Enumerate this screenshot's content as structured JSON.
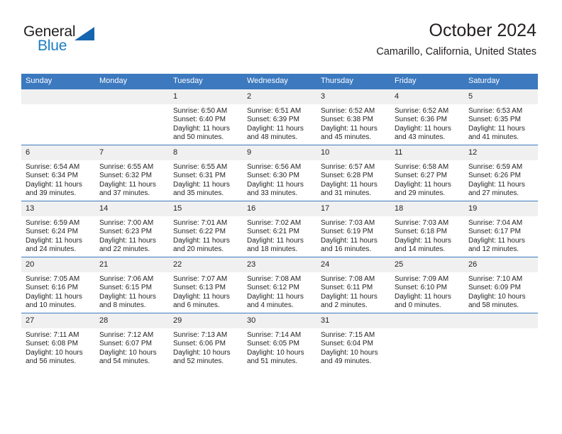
{
  "logo": {
    "word1": "General",
    "word2": "Blue",
    "icon": "triangle-icon",
    "brand_color": "#1a7dc4",
    "triangle_color": "#1565b0"
  },
  "header": {
    "title": "October 2024",
    "subtitle": "Camarillo, California, United States"
  },
  "theme": {
    "header_blue": "#3c79bf",
    "date_band": "#f0f0f0",
    "text": "#231f20"
  },
  "weekdays": [
    "Sunday",
    "Monday",
    "Tuesday",
    "Wednesday",
    "Thursday",
    "Friday",
    "Saturday"
  ],
  "weeks": [
    [
      {
        "day": "",
        "empty": true
      },
      {
        "day": "",
        "empty": true
      },
      {
        "day": "1",
        "sunrise": "Sunrise: 6:50 AM",
        "sunset": "Sunset: 6:40 PM",
        "daylight1": "Daylight: 11 hours",
        "daylight2": "and 50 minutes."
      },
      {
        "day": "2",
        "sunrise": "Sunrise: 6:51 AM",
        "sunset": "Sunset: 6:39 PM",
        "daylight1": "Daylight: 11 hours",
        "daylight2": "and 48 minutes."
      },
      {
        "day": "3",
        "sunrise": "Sunrise: 6:52 AM",
        "sunset": "Sunset: 6:38 PM",
        "daylight1": "Daylight: 11 hours",
        "daylight2": "and 45 minutes."
      },
      {
        "day": "4",
        "sunrise": "Sunrise: 6:52 AM",
        "sunset": "Sunset: 6:36 PM",
        "daylight1": "Daylight: 11 hours",
        "daylight2": "and 43 minutes."
      },
      {
        "day": "5",
        "sunrise": "Sunrise: 6:53 AM",
        "sunset": "Sunset: 6:35 PM",
        "daylight1": "Daylight: 11 hours",
        "daylight2": "and 41 minutes."
      }
    ],
    [
      {
        "day": "6",
        "sunrise": "Sunrise: 6:54 AM",
        "sunset": "Sunset: 6:34 PM",
        "daylight1": "Daylight: 11 hours",
        "daylight2": "and 39 minutes."
      },
      {
        "day": "7",
        "sunrise": "Sunrise: 6:55 AM",
        "sunset": "Sunset: 6:32 PM",
        "daylight1": "Daylight: 11 hours",
        "daylight2": "and 37 minutes."
      },
      {
        "day": "8",
        "sunrise": "Sunrise: 6:55 AM",
        "sunset": "Sunset: 6:31 PM",
        "daylight1": "Daylight: 11 hours",
        "daylight2": "and 35 minutes."
      },
      {
        "day": "9",
        "sunrise": "Sunrise: 6:56 AM",
        "sunset": "Sunset: 6:30 PM",
        "daylight1": "Daylight: 11 hours",
        "daylight2": "and 33 minutes."
      },
      {
        "day": "10",
        "sunrise": "Sunrise: 6:57 AM",
        "sunset": "Sunset: 6:28 PM",
        "daylight1": "Daylight: 11 hours",
        "daylight2": "and 31 minutes."
      },
      {
        "day": "11",
        "sunrise": "Sunrise: 6:58 AM",
        "sunset": "Sunset: 6:27 PM",
        "daylight1": "Daylight: 11 hours",
        "daylight2": "and 29 minutes."
      },
      {
        "day": "12",
        "sunrise": "Sunrise: 6:59 AM",
        "sunset": "Sunset: 6:26 PM",
        "daylight1": "Daylight: 11 hours",
        "daylight2": "and 27 minutes."
      }
    ],
    [
      {
        "day": "13",
        "sunrise": "Sunrise: 6:59 AM",
        "sunset": "Sunset: 6:24 PM",
        "daylight1": "Daylight: 11 hours",
        "daylight2": "and 24 minutes."
      },
      {
        "day": "14",
        "sunrise": "Sunrise: 7:00 AM",
        "sunset": "Sunset: 6:23 PM",
        "daylight1": "Daylight: 11 hours",
        "daylight2": "and 22 minutes."
      },
      {
        "day": "15",
        "sunrise": "Sunrise: 7:01 AM",
        "sunset": "Sunset: 6:22 PM",
        "daylight1": "Daylight: 11 hours",
        "daylight2": "and 20 minutes."
      },
      {
        "day": "16",
        "sunrise": "Sunrise: 7:02 AM",
        "sunset": "Sunset: 6:21 PM",
        "daylight1": "Daylight: 11 hours",
        "daylight2": "and 18 minutes."
      },
      {
        "day": "17",
        "sunrise": "Sunrise: 7:03 AM",
        "sunset": "Sunset: 6:19 PM",
        "daylight1": "Daylight: 11 hours",
        "daylight2": "and 16 minutes."
      },
      {
        "day": "18",
        "sunrise": "Sunrise: 7:03 AM",
        "sunset": "Sunset: 6:18 PM",
        "daylight1": "Daylight: 11 hours",
        "daylight2": "and 14 minutes."
      },
      {
        "day": "19",
        "sunrise": "Sunrise: 7:04 AM",
        "sunset": "Sunset: 6:17 PM",
        "daylight1": "Daylight: 11 hours",
        "daylight2": "and 12 minutes."
      }
    ],
    [
      {
        "day": "20",
        "sunrise": "Sunrise: 7:05 AM",
        "sunset": "Sunset: 6:16 PM",
        "daylight1": "Daylight: 11 hours",
        "daylight2": "and 10 minutes."
      },
      {
        "day": "21",
        "sunrise": "Sunrise: 7:06 AM",
        "sunset": "Sunset: 6:15 PM",
        "daylight1": "Daylight: 11 hours",
        "daylight2": "and 8 minutes."
      },
      {
        "day": "22",
        "sunrise": "Sunrise: 7:07 AM",
        "sunset": "Sunset: 6:13 PM",
        "daylight1": "Daylight: 11 hours",
        "daylight2": "and 6 minutes."
      },
      {
        "day": "23",
        "sunrise": "Sunrise: 7:08 AM",
        "sunset": "Sunset: 6:12 PM",
        "daylight1": "Daylight: 11 hours",
        "daylight2": "and 4 minutes."
      },
      {
        "day": "24",
        "sunrise": "Sunrise: 7:08 AM",
        "sunset": "Sunset: 6:11 PM",
        "daylight1": "Daylight: 11 hours",
        "daylight2": "and 2 minutes."
      },
      {
        "day": "25",
        "sunrise": "Sunrise: 7:09 AM",
        "sunset": "Sunset: 6:10 PM",
        "daylight1": "Daylight: 11 hours",
        "daylight2": "and 0 minutes."
      },
      {
        "day": "26",
        "sunrise": "Sunrise: 7:10 AM",
        "sunset": "Sunset: 6:09 PM",
        "daylight1": "Daylight: 10 hours",
        "daylight2": "and 58 minutes."
      }
    ],
    [
      {
        "day": "27",
        "sunrise": "Sunrise: 7:11 AM",
        "sunset": "Sunset: 6:08 PM",
        "daylight1": "Daylight: 10 hours",
        "daylight2": "and 56 minutes."
      },
      {
        "day": "28",
        "sunrise": "Sunrise: 7:12 AM",
        "sunset": "Sunset: 6:07 PM",
        "daylight1": "Daylight: 10 hours",
        "daylight2": "and 54 minutes."
      },
      {
        "day": "29",
        "sunrise": "Sunrise: 7:13 AM",
        "sunset": "Sunset: 6:06 PM",
        "daylight1": "Daylight: 10 hours",
        "daylight2": "and 52 minutes."
      },
      {
        "day": "30",
        "sunrise": "Sunrise: 7:14 AM",
        "sunset": "Sunset: 6:05 PM",
        "daylight1": "Daylight: 10 hours",
        "daylight2": "and 51 minutes."
      },
      {
        "day": "31",
        "sunrise": "Sunrise: 7:15 AM",
        "sunset": "Sunset: 6:04 PM",
        "daylight1": "Daylight: 10 hours",
        "daylight2": "and 49 minutes."
      },
      {
        "day": "",
        "empty": true
      },
      {
        "day": "",
        "empty": true
      }
    ]
  ]
}
